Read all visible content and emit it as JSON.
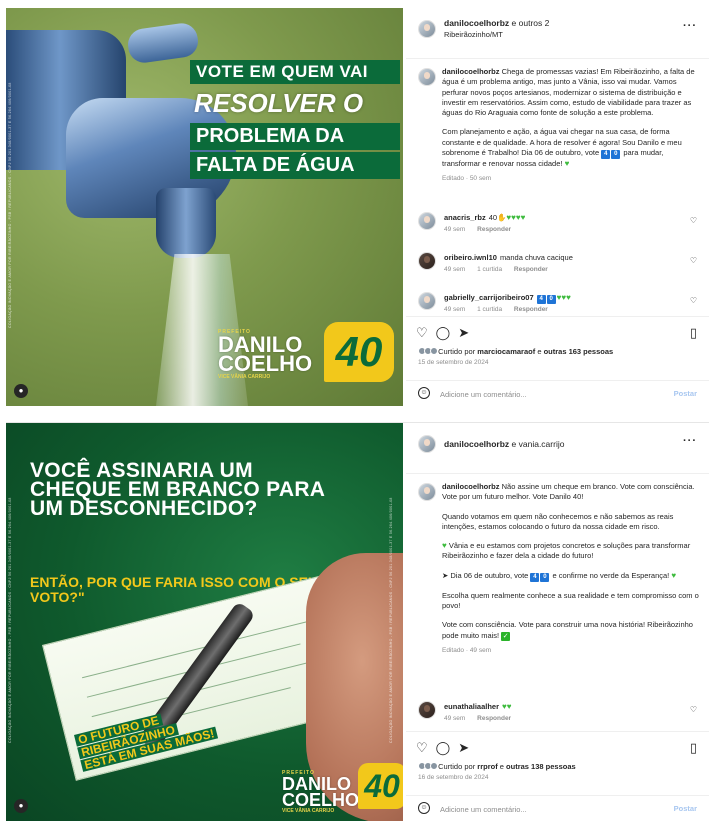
{
  "post1": {
    "header": {
      "username": "danilocoelhorbz",
      "extra": " e outros 2",
      "location": "Ribeirãozinho/MT"
    },
    "image": {
      "headline": [
        "VOTE EM QUEM VAI",
        "RESOLVER O",
        "PROBLEMA DA",
        "FALTA DE ÁGUA"
      ],
      "brand_pre": "PREFEITO",
      "brand_name1": "DANILO",
      "brand_name2": "COELHO",
      "brand_vice": "VICE VÂNIA CARRIJO",
      "number": "40",
      "legal_text": "COLIGAÇÃO INOVAÇÃO E AMOR POR RIBEIRÃOZINHO - PSB / REPUBLICANOS - CNPJ 56.201.348/0001-37 E 56.264.406/0001-08"
    },
    "caption": {
      "username": "danilocoelhorbz",
      "para1": "Chega de promessas vazias! Em Ribeirãozinho, a falta de água é um problema antigo, mas junto a Vânia, isso vai mudar. Vamos perfurar novos poços artesianos, modernizar o sistema de distribuição e investir em reservatórios. Assim como, estudo de viabilidade para trazer as águas do Rio Araguaia como fonte de solução a este problema.",
      "para2_a": "Com planejamento e ação, a água vai chegar na sua casa, de forma constante e de qualidade. A hora de resolver é agora! Sou Danilo e meu sobrenome é Trabalho! Dia 06 de outubro, vote ",
      "para2_b": " para mudar, transformar e renovar nossa cidade! ",
      "digit1": "4",
      "digit2": "0",
      "meta": "Editado · 50 sem"
    },
    "comments": [
      {
        "user": "anacris_rbz",
        "text": "40",
        "time": "49 sem",
        "likes": "",
        "reply": "Responder",
        "hearts": 4,
        "fingers": true
      },
      {
        "user": "oribeiro.iwnl10",
        "text": "manda chuva cacique",
        "time": "49 sem",
        "likes": "1 curtida",
        "reply": "Responder"
      },
      {
        "user": "gabrielly_carrijoribeiro07",
        "text": "",
        "time": "49 sem",
        "likes": "1 curtida",
        "reply": "Responder",
        "boxes": [
          "4",
          "0"
        ],
        "hearts": 3
      }
    ],
    "liked_by": {
      "prefix": "Curtido por ",
      "user": "marciocamaraof",
      "middle": " e ",
      "others": "outras 163 pessoas"
    },
    "date": "15 de setembro de 2024",
    "comment_placeholder": "Adicione um comentário...",
    "post_label": "Postar"
  },
  "post2": {
    "header": {
      "username": "danilocoelhorbz",
      "extra": " e vania.carrijo"
    },
    "image": {
      "question": "VOCÊ ASSINARIA UM CHEQUE EM BRANCO PARA UM DESCONHECIDO?",
      "sub": "ENTÃO, POR QUE FARIA ISSO COM O SEU VOTO?\"",
      "cheque_line1": "O FUTURO DE",
      "cheque_line2": "RIBEIRÃOZINHO",
      "cheque_line3": "ESTÁ EM SUAS MÃOS!",
      "brand_pre": "PREFEITO",
      "brand_name1": "DANILO",
      "brand_name2": "COELHO",
      "brand_vice": "VICE VÂNIA CARRIJO",
      "number": "40",
      "legal_text": "COLIGAÇÃO INOVAÇÃO E AMOR POR RIBEIRÃOZINHO - PSB / REPUBLICANOS - CNPJ 56.201.348/0001-37 E 56.264.406/0001-08"
    },
    "caption": {
      "username": "danilocoelhorbz",
      "para1": "Não assine um cheque em branco. Vote com consciência. Vote por um futuro melhor. Vote Danilo 40!",
      "para2": "Quando votamos em quem não conhecemos e não sabemos as reais intenções, estamos colocando o futuro da nossa cidade em risco.",
      "para3": " Vânia e eu estamos com projetos concretos e soluções para transformar Ribeirãozinho e fazer dela a cidade do futuro!",
      "para4_a": " Dia 06 de outubro, vote ",
      "para4_b": " e confirme no verde da Esperança! ",
      "digit1": "4",
      "digit2": "0",
      "para5": "Escolha quem realmente conhece a sua realidade e tem compromisso com o povo!",
      "para6": "Vote com consciência. Vote para construir uma nova história! Ribeirãozinho pode muito mais! ",
      "meta": "Editado · 49 sem"
    },
    "comments": [
      {
        "user": "eunathaliaalher",
        "time": "49 sem",
        "reply": "Responder",
        "hearts": 2
      }
    ],
    "liked_by": {
      "prefix": "Curtido por ",
      "user": "rrprof",
      "middle": " e ",
      "others": "outras 138 pessoas"
    },
    "date": "16 de setembro de 2024",
    "comment_placeholder": "Adicione um comentário...",
    "post_label": "Postar"
  },
  "icons": {
    "more": "more-options-icon",
    "like": "heart-icon",
    "comment": "comment-icon",
    "share": "share-icon",
    "save": "bookmark-icon",
    "emoji": "emoji-icon",
    "tag": "tagged-user-icon"
  },
  "colors": {
    "brand_green": "#0b6b3a",
    "brand_yellow": "#f2c81b",
    "link_blue": "#1f74d6",
    "muted": "#8e8e8e"
  }
}
